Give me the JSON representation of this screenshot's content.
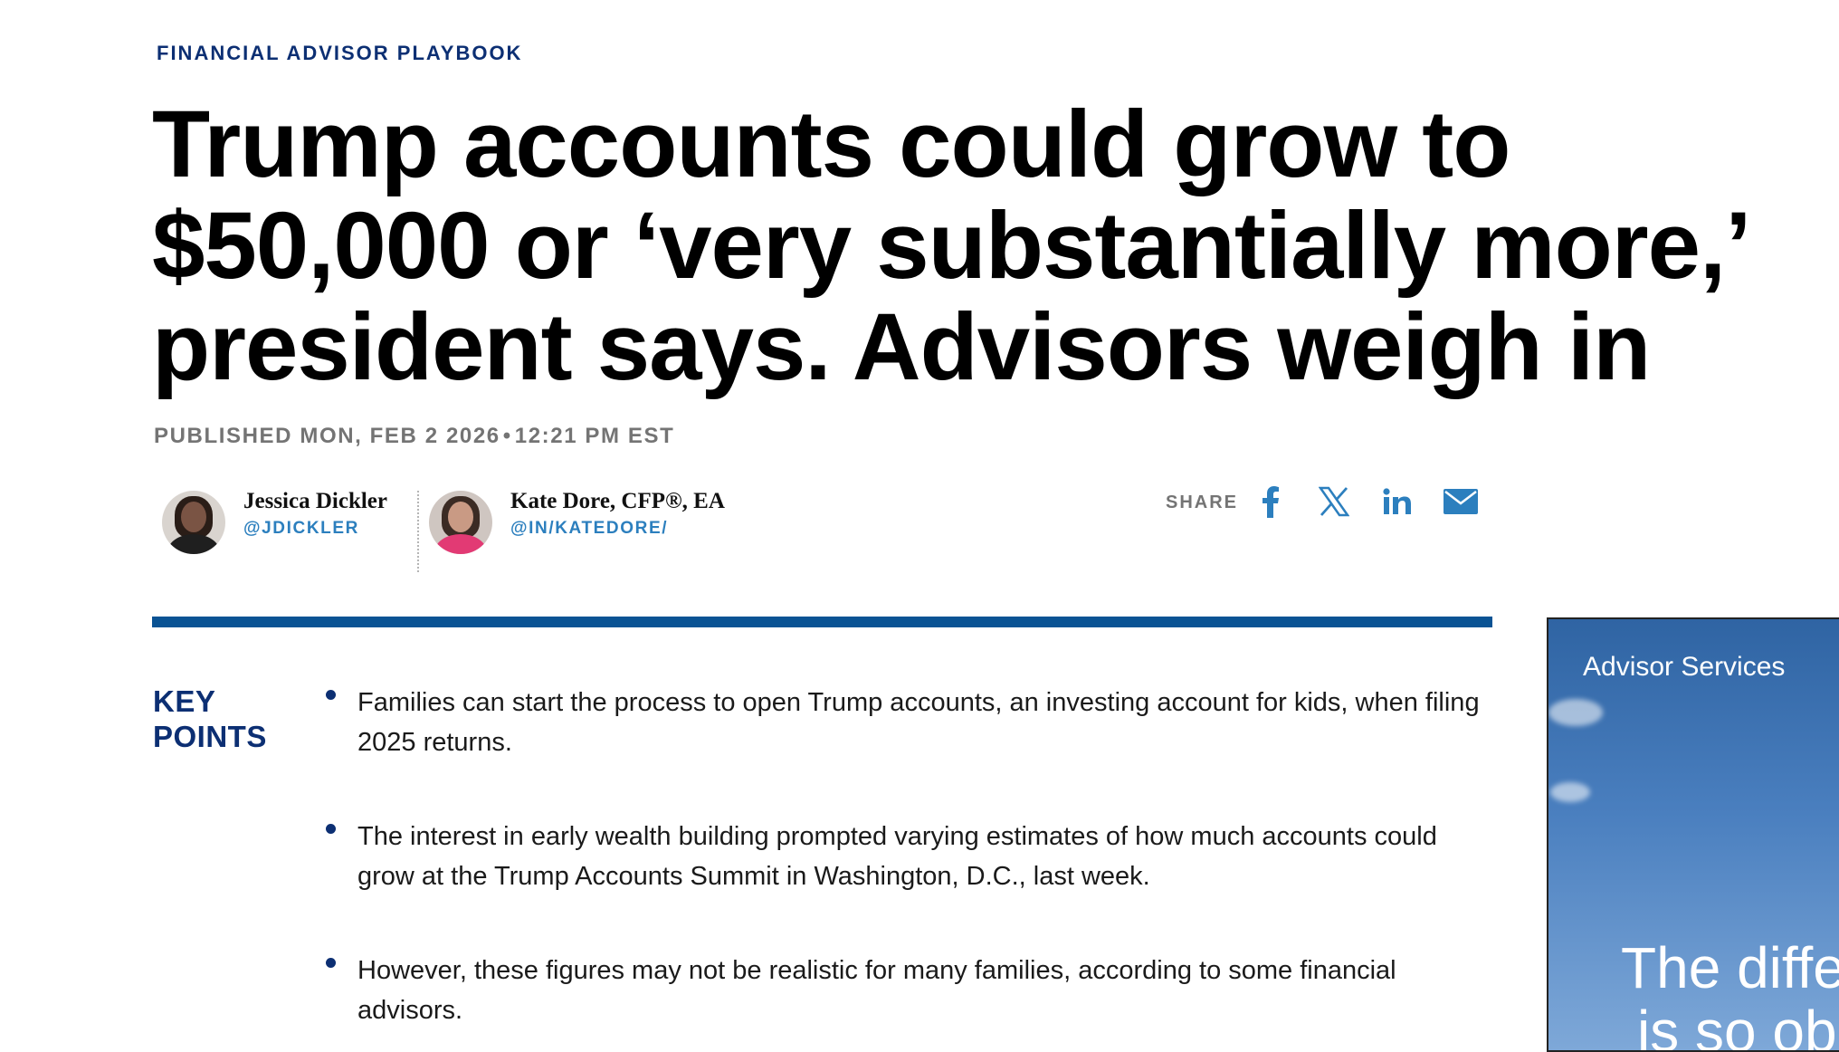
{
  "article": {
    "kicker": "FINANCIAL ADVISOR PLAYBOOK",
    "headline": "Trump accounts could grow to $50,000 or ‘very substantially more,’ president says. Advisors weigh in",
    "published_label": "PUBLISHED MON, FEB 2 2026",
    "published_separator": "•",
    "published_time": "12:21 PM EST"
  },
  "authors": [
    {
      "name": "Jessica Dickler",
      "handle": "@JDICKLER"
    },
    {
      "name": "Kate Dore, CFP®, EA",
      "handle": "@IN/KATEDORE/"
    }
  ],
  "share": {
    "label": "SHARE",
    "icons": [
      "facebook-icon",
      "x-icon",
      "linkedin-icon",
      "email-icon"
    ]
  },
  "key_points": {
    "label": "KEY POINTS",
    "items": [
      "Families can start the process to open Trump accounts, an investing account for kids, when filing 2025 returns.",
      "The interest in early wealth building prompted varying estimates of how much accounts could grow at the Trump Accounts Summit in Washington, D.C., last week.",
      "However, these figures may not be realistic for many families, according to some financial advisors."
    ]
  },
  "ad": {
    "brand": "Advisor Services",
    "tagline_line1": "The diffe",
    "tagline_line2": "is so ob"
  },
  "colors": {
    "accent_navy": "#0c2f73",
    "rule_blue": "#0a5394",
    "link_blue": "#2c7fbe",
    "meta_gray": "#747474"
  }
}
